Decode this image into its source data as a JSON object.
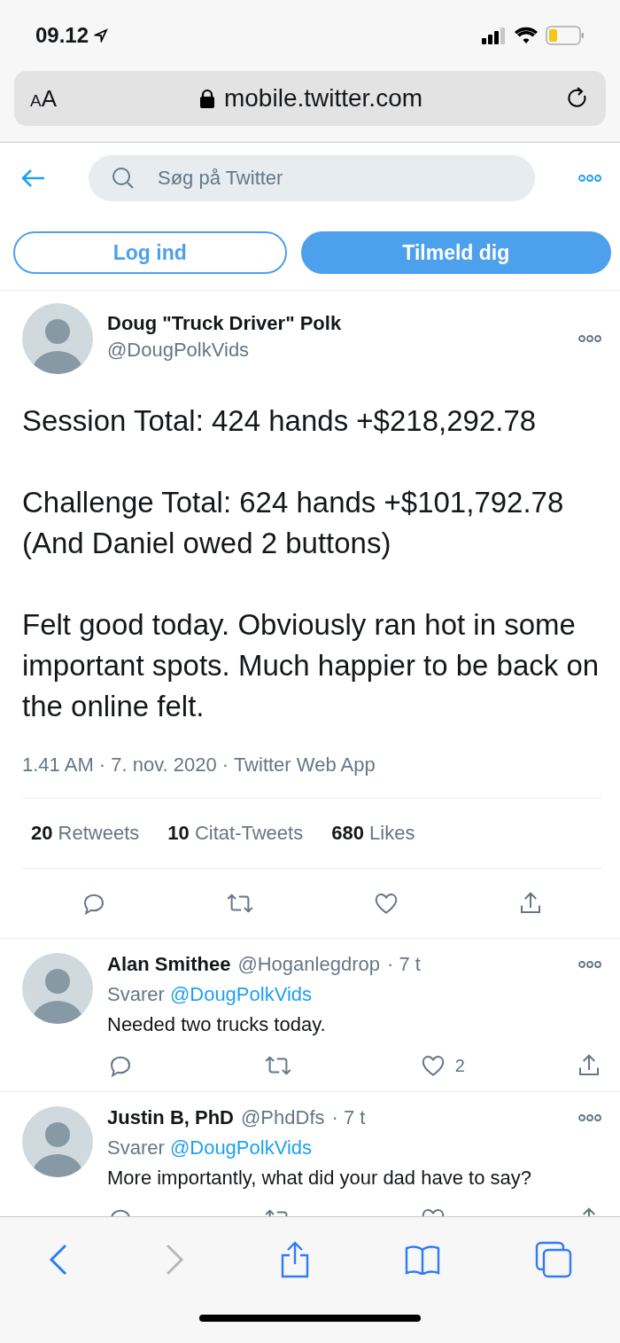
{
  "status_bar": {
    "time": "09.12"
  },
  "address_bar": {
    "text_size": "AA",
    "url": "mobile.twitter.com"
  },
  "nav": {
    "search": {
      "placeholder": "Søg på Twitter"
    }
  },
  "auth_buttons": [
    {
      "label": "Log ind",
      "kind": "outline"
    },
    {
      "label": "Tilmeld dig",
      "kind": "filled"
    }
  ],
  "tweet": {
    "name": "Doug \"Truck Driver\" Polk",
    "handle": "@DougPolkVids",
    "paragraphs": [
      "Session Total: 424 hands +$218,292.78",
      "Challenge Total: 624 hands +$101,792.78\n(And Daniel owed 2 buttons)",
      "Felt good today. Obviously ran hot in some important spots. Much happier to be back on the online felt."
    ],
    "meta": "1.41 AM · 7. nov. 2020 · Twitter Web App",
    "stats": [
      {
        "count": "20",
        "label": "Retweets"
      },
      {
        "count": "10",
        "label": "Citat-Tweets"
      },
      {
        "count": "680",
        "label": "Likes"
      }
    ]
  },
  "replies": [
    {
      "name": "Alan Smithee",
      "handle": "@Hoganlegdrop",
      "time": "· 7 t",
      "replying_label": "Svarer",
      "replying_to": "@DougPolkVids",
      "text": "Needed two trucks today.",
      "likes": "2"
    },
    {
      "name": "Justin B, PhD",
      "handle": "@PhdDfs",
      "time": "· 7 t",
      "replying_label": "Svarer",
      "replying_to": "@DougPolkVids",
      "text": "More importantly, what did your dad have to say?"
    }
  ]
}
